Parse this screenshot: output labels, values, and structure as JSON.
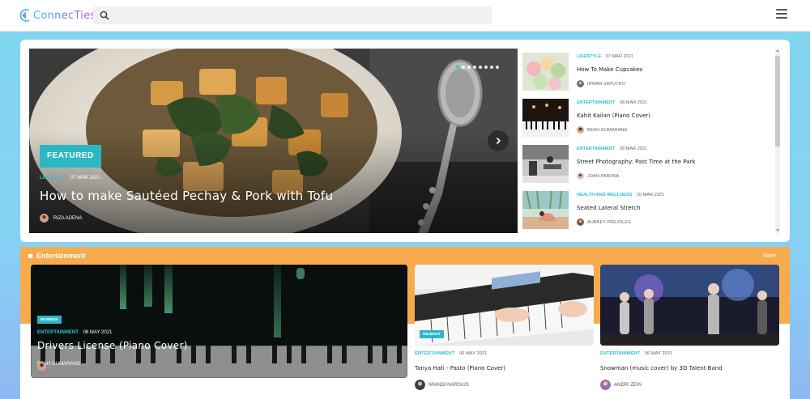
{
  "header": {
    "logo_text": "ConnecTies",
    "search": {
      "placeholder": "",
      "value": ""
    },
    "icons": {
      "search": "search-icon",
      "menu": "hamburger-menu-icon"
    }
  },
  "hero": {
    "badge": "FEATURED",
    "category": "LIFESTYLE",
    "date": "07 MAR 2021",
    "title": "How to make Sautéed Pechay & Pork with Tofu",
    "author": "RIZA ADENA",
    "carousel": {
      "slide_count": 8,
      "active_index": 0
    },
    "next_icon": "chevron-right-icon"
  },
  "side_list": [
    {
      "category": "LIFESTYLE",
      "date": "07 MAR 2021",
      "title": "How To Make Cupcakes",
      "author": "IRWAN SAPUTRO"
    },
    {
      "category": "ENTERTAINMENT",
      "date": "08 MAR 2021",
      "title": "Kahit Kailan (Piano Cover)",
      "author": "BEAH GUMARANG"
    },
    {
      "category": "ENTERTAINMENT",
      "date": "09 MAR 2021",
      "title": "Street Photography: Past Time at the Park",
      "author": "JOAN PABONA"
    },
    {
      "category": "HEALTH AND WELLNESS",
      "date": "10 MAR 2021",
      "title": "Seated Lateral Stretch",
      "author": "AUBREY PREJOLES"
    }
  ],
  "entertainment": {
    "title": "Entertainment",
    "more_label": "More",
    "featured": {
      "badge": "MEMBER",
      "category": "ENTERTAINMENT",
      "date": "06 MAY 2021",
      "title": "Drivers License (Piano Cover)",
      "author": "BEAH GUMARANG"
    },
    "cards": [
      {
        "badge": "MEMBER",
        "category": "ENTERTAINMENT",
        "date": "06 MAY 2021",
        "title": "Tanya Hati - Pasto (Piano Cover)",
        "author": "IWANDI NARSIUS"
      },
      {
        "category": "ENTERTAINMENT",
        "date": "06 MAY 2021",
        "title": "Snowman (music cover) by 3D Talent Band",
        "author": "ANDRI ZEIN"
      }
    ]
  },
  "colors": {
    "accent": "#2bb7c6",
    "section_orange": "#f7ab4d",
    "page_bg": "#86d2f5"
  }
}
